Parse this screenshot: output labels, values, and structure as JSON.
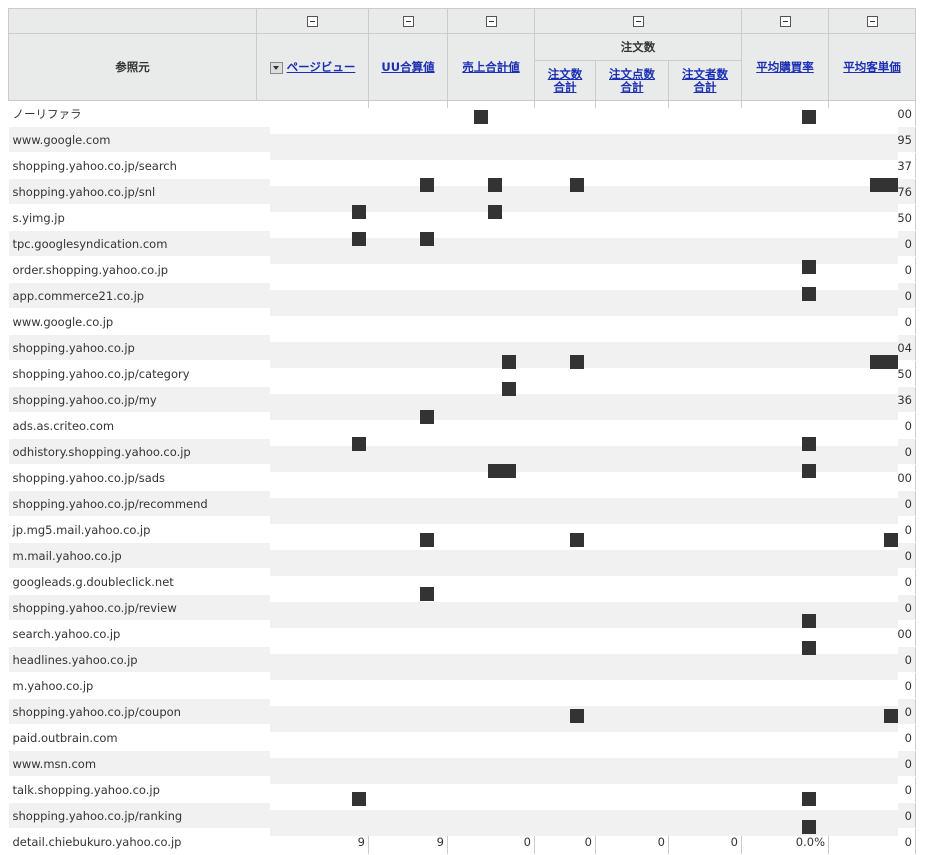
{
  "header": {
    "referrer": "参照元",
    "page_views": "ページビュー",
    "uu_total": "UU合算値",
    "sales_total": "売上合計値",
    "orders_group": "注文数",
    "order_count_total": "注文数合計",
    "order_points_total": "注文点数合計",
    "orderers_total": "注文者数合計",
    "avg_purchase_rate": "平均購買率",
    "avg_unit_price": "平均客単価"
  },
  "rows": [
    {
      "source": "ノーリファラ",
      "pv": "",
      "uu": "",
      "sales": "",
      "orders": "",
      "points": "",
      "orderers": "",
      "rate": "",
      "price": "00"
    },
    {
      "source": "www.google.com",
      "pv": "",
      "uu": "",
      "sales": "",
      "orders": "",
      "points": "",
      "orderers": "",
      "rate": "",
      "price": "95"
    },
    {
      "source": "shopping.yahoo.co.jp/search",
      "pv": "",
      "uu": "",
      "sales": "",
      "orders": "",
      "points": "",
      "orderers": "",
      "rate": "",
      "price": "37"
    },
    {
      "source": "shopping.yahoo.co.jp/snl",
      "pv": "",
      "uu": "",
      "sales": "",
      "orders": "",
      "points": "",
      "orderers": "",
      "rate": "",
      "price": "76"
    },
    {
      "source": "s.yimg.jp",
      "pv": "",
      "uu": "",
      "sales": "",
      "orders": "",
      "points": "",
      "orderers": "",
      "rate": "",
      "price": "50"
    },
    {
      "source": "tpc.googlesyndication.com",
      "pv": "",
      "uu": "",
      "sales": "",
      "orders": "",
      "points": "",
      "orderers": "",
      "rate": "",
      "price": "0"
    },
    {
      "source": "order.shopping.yahoo.co.jp",
      "pv": "",
      "uu": "",
      "sales": "",
      "orders": "",
      "points": "",
      "orderers": "",
      "rate": "",
      "price": "0"
    },
    {
      "source": "app.commerce21.co.jp",
      "pv": "",
      "uu": "",
      "sales": "",
      "orders": "",
      "points": "",
      "orderers": "",
      "rate": "",
      "price": "0"
    },
    {
      "source": "www.google.co.jp",
      "pv": "",
      "uu": "",
      "sales": "",
      "orders": "",
      "points": "",
      "orderers": "",
      "rate": "",
      "price": "0"
    },
    {
      "source": "shopping.yahoo.co.jp",
      "pv": "",
      "uu": "",
      "sales": "",
      "orders": "",
      "points": "",
      "orderers": "",
      "rate": "",
      "price": "04"
    },
    {
      "source": "shopping.yahoo.co.jp/category",
      "pv": "",
      "uu": "",
      "sales": "",
      "orders": "",
      "points": "",
      "orderers": "",
      "rate": "",
      "price": "50"
    },
    {
      "source": "shopping.yahoo.co.jp/my",
      "pv": "",
      "uu": "",
      "sales": "",
      "orders": "",
      "points": "",
      "orderers": "",
      "rate": "",
      "price": "36"
    },
    {
      "source": "ads.as.criteo.com",
      "pv": "",
      "uu": "",
      "sales": "",
      "orders": "",
      "points": "",
      "orderers": "",
      "rate": "",
      "price": "0"
    },
    {
      "source": "odhistory.shopping.yahoo.co.jp",
      "pv": "",
      "uu": "",
      "sales": "",
      "orders": "",
      "points": "",
      "orderers": "",
      "rate": "",
      "price": "0"
    },
    {
      "source": "shopping.yahoo.co.jp/sads",
      "pv": "",
      "uu": "",
      "sales": "",
      "orders": "",
      "points": "",
      "orderers": "",
      "rate": "",
      "price": "00"
    },
    {
      "source": "shopping.yahoo.co.jp/recommend",
      "pv": "",
      "uu": "",
      "sales": "",
      "orders": "",
      "points": "",
      "orderers": "",
      "rate": "",
      "price": "0"
    },
    {
      "source": "jp.mg5.mail.yahoo.co.jp",
      "pv": "",
      "uu": "",
      "sales": "",
      "orders": "",
      "points": "",
      "orderers": "",
      "rate": "",
      "price": "0"
    },
    {
      "source": "m.mail.yahoo.co.jp",
      "pv": "",
      "uu": "",
      "sales": "",
      "orders": "",
      "points": "",
      "orderers": "",
      "rate": "",
      "price": "0"
    },
    {
      "source": "googleads.g.doubleclick.net",
      "pv": "",
      "uu": "",
      "sales": "",
      "orders": "",
      "points": "",
      "orderers": "",
      "rate": "",
      "price": "0"
    },
    {
      "source": "shopping.yahoo.co.jp/review",
      "pv": "",
      "uu": "",
      "sales": "",
      "orders": "",
      "points": "",
      "orderers": "",
      "rate": "",
      "price": "0"
    },
    {
      "source": "search.yahoo.co.jp",
      "pv": "",
      "uu": "",
      "sales": "",
      "orders": "",
      "points": "",
      "orderers": "",
      "rate": "",
      "price": "00"
    },
    {
      "source": "headlines.yahoo.co.jp",
      "pv": "",
      "uu": "",
      "sales": "",
      "orders": "",
      "points": "",
      "orderers": "",
      "rate": "",
      "price": "0"
    },
    {
      "source": "m.yahoo.co.jp",
      "pv": "",
      "uu": "",
      "sales": "",
      "orders": "",
      "points": "",
      "orderers": "",
      "rate": "",
      "price": "0"
    },
    {
      "source": "shopping.yahoo.co.jp/coupon",
      "pv": "",
      "uu": "",
      "sales": "",
      "orders": "",
      "points": "",
      "orderers": "",
      "rate": "",
      "price": "0"
    },
    {
      "source": "paid.outbrain.com",
      "pv": "",
      "uu": "",
      "sales": "",
      "orders": "",
      "points": "",
      "orderers": "",
      "rate": "",
      "price": "0"
    },
    {
      "source": "www.msn.com",
      "pv": "",
      "uu": "",
      "sales": "",
      "orders": "",
      "points": "",
      "orderers": "",
      "rate": "",
      "price": "0"
    },
    {
      "source": "talk.shopping.yahoo.co.jp",
      "pv": "",
      "uu": "",
      "sales": "",
      "orders": "",
      "points": "",
      "orderers": "",
      "rate": "",
      "price": "0"
    },
    {
      "source": "shopping.yahoo.co.jp/ranking",
      "pv": "",
      "uu": "",
      "sales": "",
      "orders": "",
      "points": "",
      "orderers": "",
      "rate": "",
      "price": "0"
    },
    {
      "source": "detail.chiebukuro.yahoo.co.jp",
      "pv": "9",
      "uu": "9",
      "sales": "0",
      "orders": "0",
      "points": "0",
      "orderers": "0",
      "rate": "0.0%",
      "price": "0"
    }
  ],
  "colors": {
    "header_bg": "#e9ebea",
    "border": "#c8cccc",
    "link": "#1c2fb4",
    "alt_row": "#f1f1f1",
    "redaction": "#333333"
  },
  "icons": [
    "collapse-icon",
    "sort-desc-icon"
  ]
}
